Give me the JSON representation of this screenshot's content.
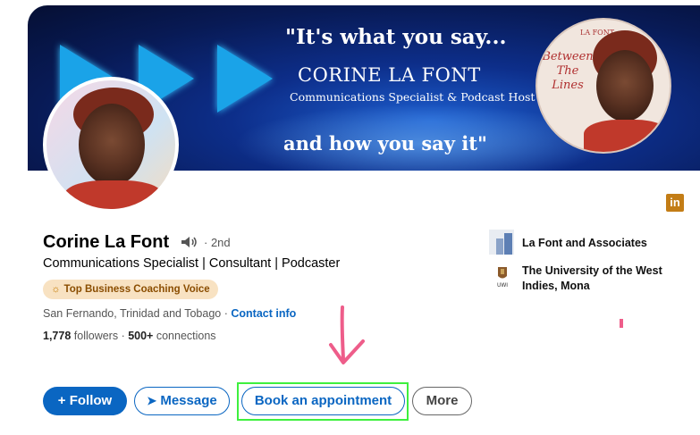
{
  "banner": {
    "quote": "\"It's what you say...",
    "name": "CORINE LA FONT",
    "title": "Communications Specialist & Podcast Host",
    "tagline": "and how you say it\"",
    "book_top": "LA FONT",
    "book_title": "Between The Lines"
  },
  "profile": {
    "name": "Corine La Font",
    "degree": "· 2nd",
    "headline": "Communications Specialist | Consultant | Podcaster",
    "badge": "Top Business Coaching Voice",
    "location": "San Fernando, Trinidad and Tobago ·",
    "contact_link": "Contact info",
    "followers_count": "1,778",
    "followers_label": "followers",
    "connections_count": "500+",
    "connections_label": "connections"
  },
  "experience": {
    "company": "La Font and Associates",
    "education": "The University of the West Indies, Mona",
    "uni_logo_text": "UWI"
  },
  "actions": {
    "follow": "Follow",
    "message": "Message",
    "book": "Book an appointment",
    "more": "More"
  },
  "icons": {
    "linkedin": "in",
    "follow_plus": "+",
    "message_send": "➤",
    "speaker": "🔊",
    "badge_sun": "☼"
  },
  "colors": {
    "brand_blue": "#0a66c2",
    "highlight_green": "#3ef03e",
    "arrow_pink": "#ee5d8a",
    "badge_bg": "#f8e2c2"
  }
}
